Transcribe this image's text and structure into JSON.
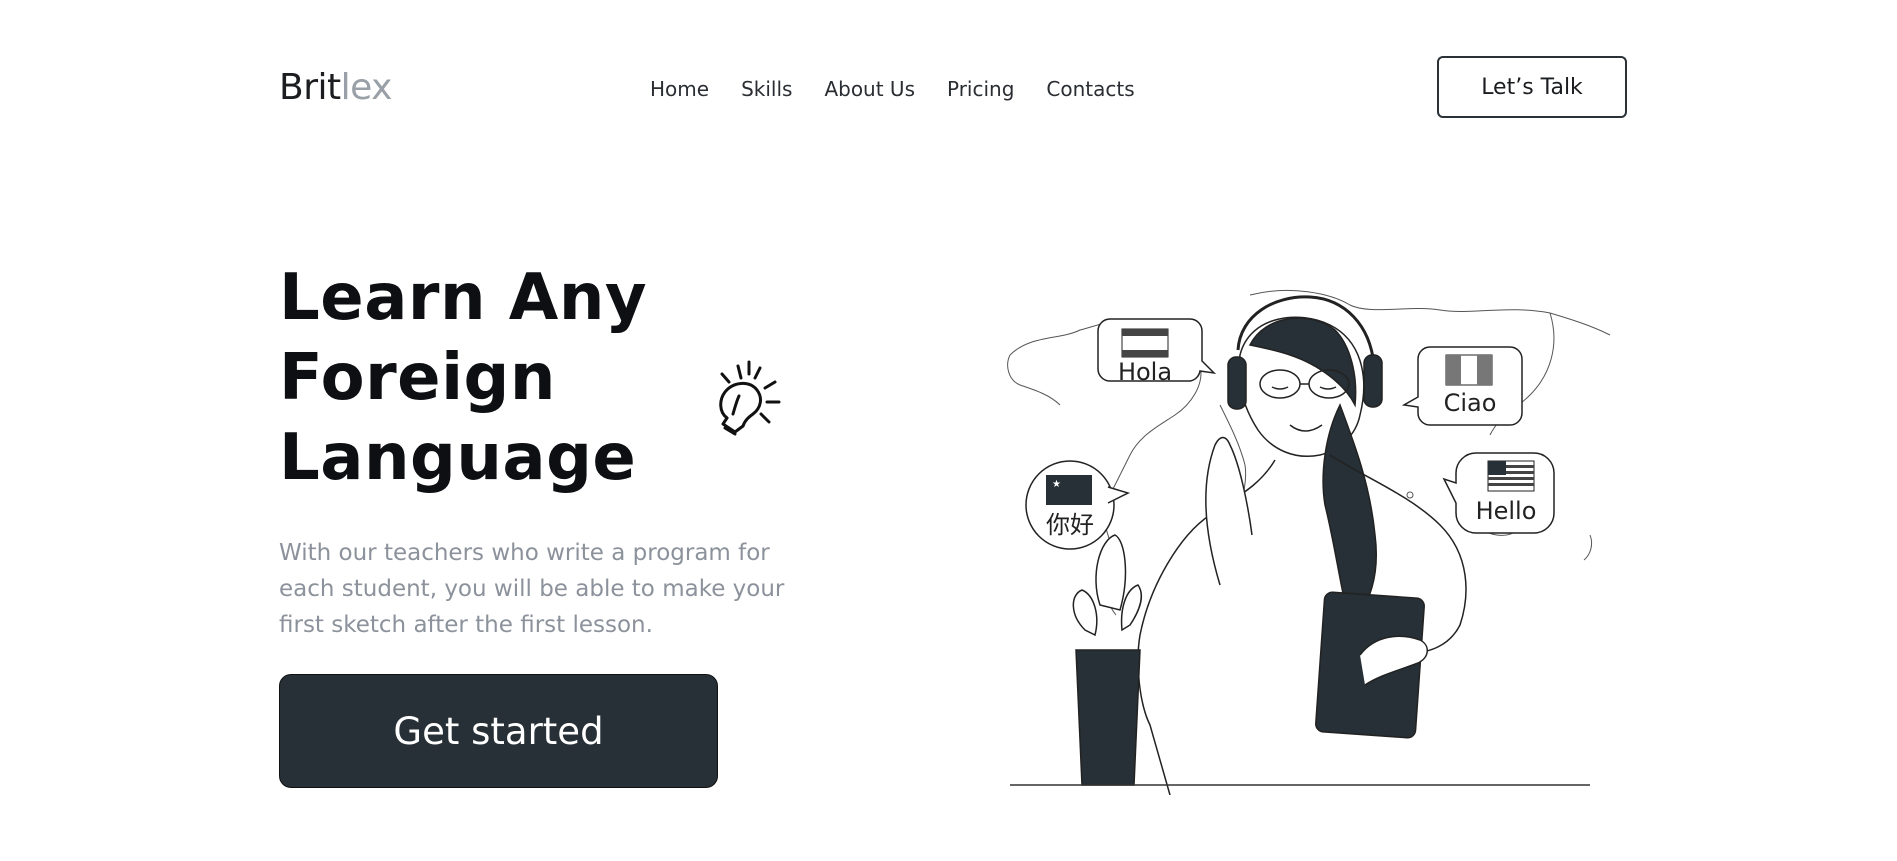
{
  "brand": {
    "part1": "Brit",
    "part2": "lex"
  },
  "nav": {
    "items": [
      {
        "label": "Home"
      },
      {
        "label": "Skills"
      },
      {
        "label": "About Us"
      },
      {
        "label": "Pricing"
      },
      {
        "label": "Contacts"
      }
    ]
  },
  "header": {
    "cta_label": "Let’s Talk"
  },
  "hero": {
    "title_lines": [
      "Learn Any",
      "Foreign",
      "Language"
    ],
    "subtitle": "With our teachers who write a program for each student, you will be able to make your first sketch after the first lesson.",
    "cta_label": "Get started"
  },
  "illustration": {
    "bubbles": [
      {
        "text": "Hola",
        "flag": "spain-flag"
      },
      {
        "text": "Ciao",
        "flag": "italy-flag"
      },
      {
        "text": "你好",
        "flag": "china-flag"
      },
      {
        "text": "Hello",
        "flag": "usa-flag"
      }
    ]
  },
  "colors": {
    "dark": "#263036",
    "muted_text": "#8c929b",
    "logo_accent": "#9aa0a8",
    "background": "#ffffff"
  }
}
